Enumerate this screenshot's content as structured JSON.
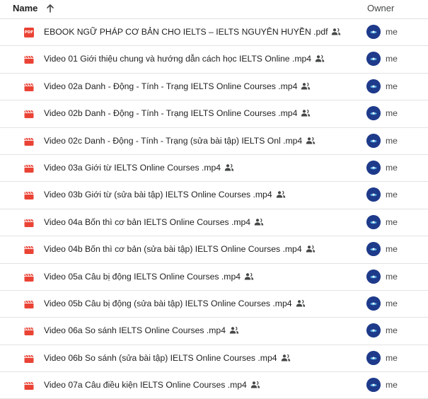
{
  "header": {
    "name_label": "Name",
    "sort_icon": "arrow-up-icon",
    "owner_label": "Owner"
  },
  "colors": {
    "pdf_red": "#ea4335",
    "video_red": "#ea4335",
    "avatar_blue": "#1e3a8a"
  },
  "files": [
    {
      "name": "EBOOK NGỮ PHÁP CƠ BẢN CHO IELTS – IELTS NGUYÊN HUYỀN .pdf",
      "type": "pdf",
      "shared": true,
      "owner": "me"
    },
    {
      "name": "Video 01 Giới thiệu chung và hướng dẫn cách học IELTS Online .mp4",
      "type": "video",
      "shared": true,
      "owner": "me"
    },
    {
      "name": "Video 02a Danh - Động - Tính - Trạng IELTS Online Courses .mp4",
      "type": "video",
      "shared": true,
      "owner": "me"
    },
    {
      "name": "Video 02b Danh - Động - Tính - Trạng IELTS Online Courses .mp4",
      "type": "video",
      "shared": true,
      "owner": "me"
    },
    {
      "name": "Video 02c Danh - Động - Tính - Trạng (sửa bài tập) IELTS Onl .mp4",
      "type": "video",
      "shared": true,
      "owner": "me"
    },
    {
      "name": "Video 03a Giới từ IELTS Online Courses .mp4",
      "type": "video",
      "shared": true,
      "owner": "me"
    },
    {
      "name": "Video 03b Giới từ (sửa bài tập) IELTS Online Courses .mp4",
      "type": "video",
      "shared": true,
      "owner": "me"
    },
    {
      "name": "Video 04a Bốn thì cơ bản IELTS Online Courses .mp4",
      "type": "video",
      "shared": true,
      "owner": "me"
    },
    {
      "name": "Video 04b Bốn thì cơ bản (sửa bài tập) IELTS Online Courses .mp4",
      "type": "video",
      "shared": true,
      "owner": "me"
    },
    {
      "name": "Video 05a Câu bị động IELTS Online Courses .mp4",
      "type": "video",
      "shared": true,
      "owner": "me"
    },
    {
      "name": "Video 05b Câu bị động (sửa bài tập) IELTS Online Courses .mp4",
      "type": "video",
      "shared": true,
      "owner": "me"
    },
    {
      "name": "Video 06a So sánh IELTS Online Courses .mp4",
      "type": "video",
      "shared": true,
      "owner": "me"
    },
    {
      "name": "Video 06b So sánh (sửa bài tập) IELTS Online Courses .mp4",
      "type": "video",
      "shared": true,
      "owner": "me"
    },
    {
      "name": "Video 07a Câu điều kiện IELTS Online Courses .mp4",
      "type": "video",
      "shared": true,
      "owner": "me"
    }
  ]
}
